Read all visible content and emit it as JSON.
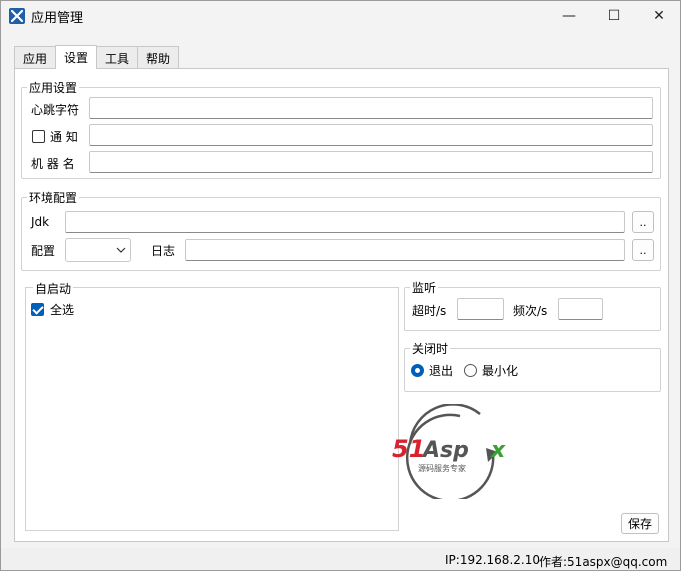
{
  "window": {
    "title": "应用管理",
    "controls": {
      "minimize": "—",
      "maximize": "☐",
      "close": "✕"
    }
  },
  "tabs": [
    {
      "label": "应用",
      "active": false
    },
    {
      "label": "设置",
      "active": true
    },
    {
      "label": "工具",
      "active": false
    },
    {
      "label": "帮助",
      "active": false
    }
  ],
  "app_settings": {
    "legend": "应用设置",
    "heartbeat_label": "心跳字符",
    "heartbeat_value": "",
    "notify_label": "通 知",
    "notify_checked": false,
    "notify_value": "",
    "machine_label": "机 器 名",
    "machine_value": ""
  },
  "env_config": {
    "legend": "环境配置",
    "jdk_label": "Jdk",
    "jdk_value": "",
    "jdk_browse": "..",
    "config_label": "配置",
    "config_value": "",
    "log_label": "日志",
    "log_value": "",
    "log_browse": ".."
  },
  "autostart": {
    "legend": "自启动",
    "select_all_label": "全选",
    "select_all_checked": true
  },
  "monitor": {
    "legend": "监听",
    "timeout_label": "超时/s",
    "timeout_value": "",
    "frequency_label": "频次/s",
    "frequency_value": ""
  },
  "on_close": {
    "legend": "关闭时",
    "exit_label": "退出",
    "minimize_label": "最小化",
    "selected": "exit"
  },
  "logo": {
    "brand_main": "51Aspx",
    "tagline": "源码服务专家",
    "colors": {
      "red": "#d7232f",
      "green": "#3aa135",
      "gray": "#555555"
    }
  },
  "save_label": "保存",
  "statusbar": {
    "ip": "IP:192.168.2.10",
    "author": "作者:51aspx@qq.com"
  },
  "accent_color": "#005fb8"
}
